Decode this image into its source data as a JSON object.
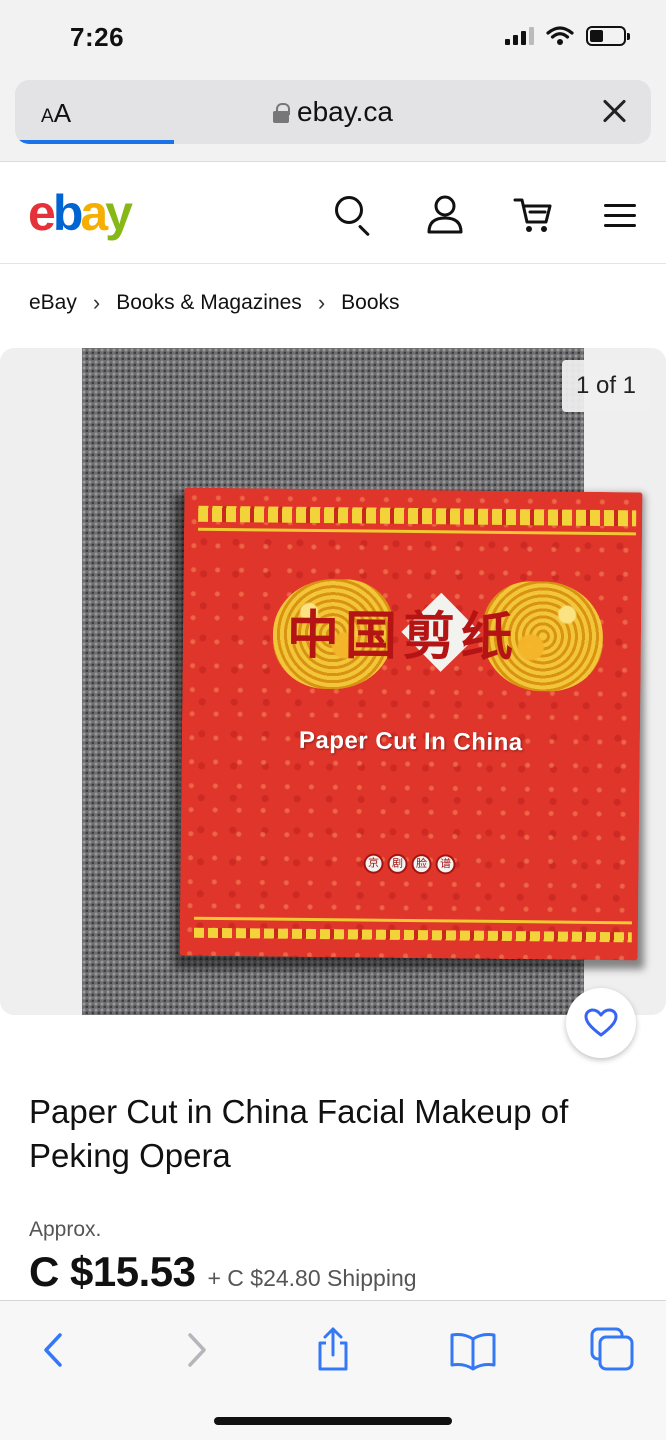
{
  "status_bar": {
    "time": "7:26"
  },
  "browser": {
    "text_size_small": "A",
    "text_size_large": "A",
    "url": "ebay.ca",
    "load_progress": 0.25
  },
  "ebay": {
    "logo": {
      "e": "e",
      "b": "b",
      "a": "a",
      "y": "y"
    },
    "header_icons": [
      "search-icon",
      "user-icon",
      "cart-icon",
      "menu-icon"
    ]
  },
  "breadcrumb": [
    "eBay",
    "Books & Magazines",
    "Books"
  ],
  "gallery": {
    "counter": "1 of 1",
    "book_title": "Paper Cut In China",
    "book_chinese_title": "中国剪纸",
    "book_opera_chars": [
      "京",
      "剧",
      "脸",
      "谱"
    ]
  },
  "listing": {
    "title": "Paper Cut in China Facial Makeup of Peking Opera",
    "approx_label": "Approx.",
    "price": "C $15.53",
    "shipping": "+ C $24.80 Shipping"
  },
  "colors": {
    "ebay_red": "#e53238",
    "ebay_blue": "#0064d2",
    "ebay_yellow": "#f5af02",
    "ebay_green": "#86b817",
    "safari_blue": "#1a73e8",
    "toolbar_icon_blue": "#3478f6"
  },
  "toolbar": [
    "back-icon",
    "forward-icon",
    "share-icon",
    "bookmarks-icon",
    "tabs-icon"
  ]
}
